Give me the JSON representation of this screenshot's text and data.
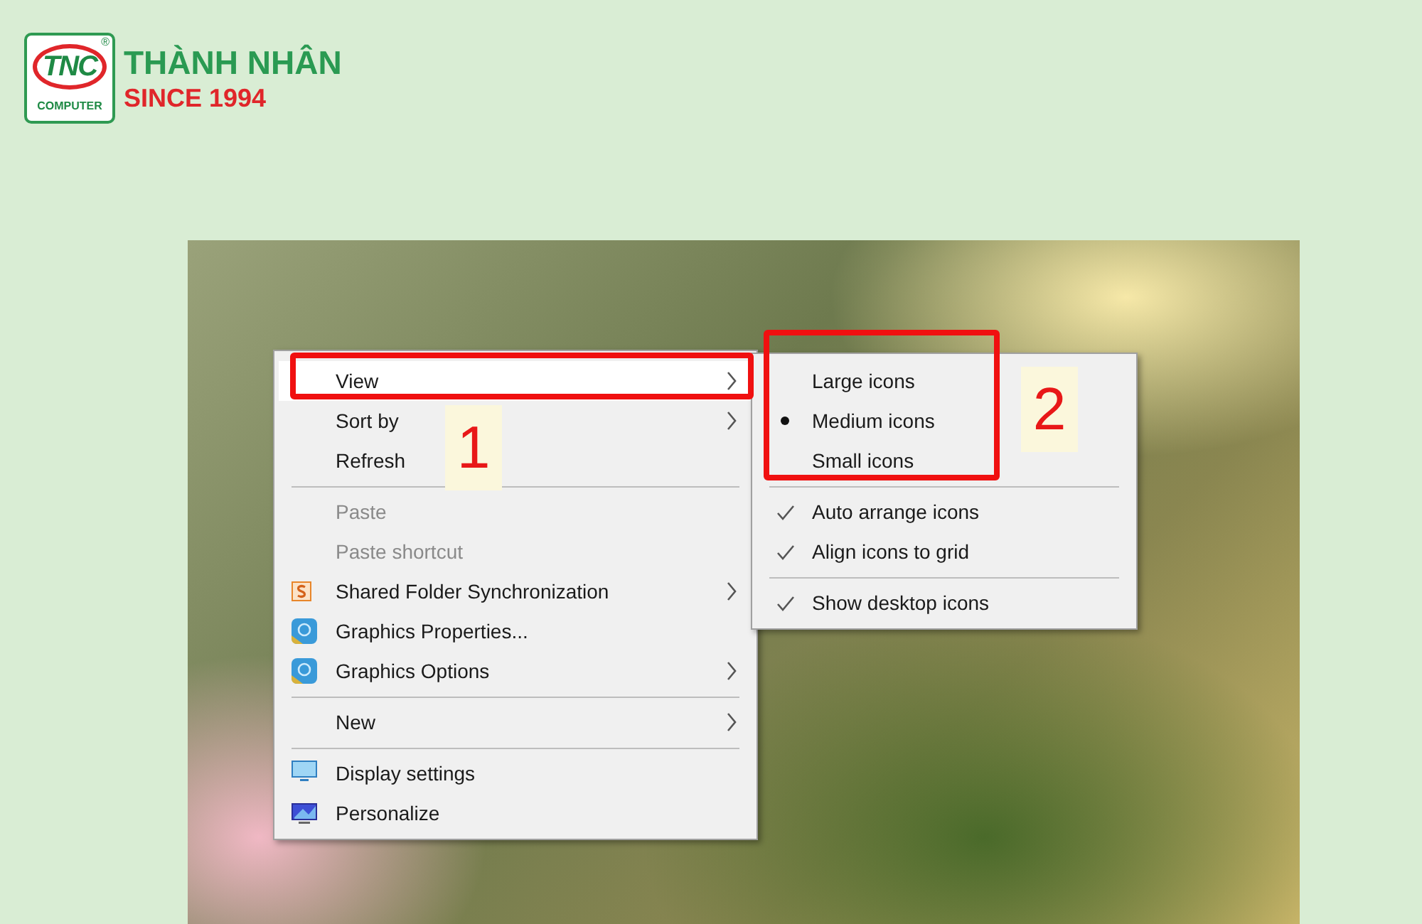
{
  "logo": {
    "mark": "TNC",
    "registered": "®",
    "subtitle": "COMPUTER",
    "name": "THÀNH NHÂN",
    "tagline": "SINCE 1994"
  },
  "context_menu": {
    "items": [
      {
        "kind": "item",
        "label": "View",
        "highlighted": true,
        "disabled": false,
        "submenu": true
      },
      {
        "kind": "item",
        "label": "Sort by",
        "highlighted": false,
        "disabled": false,
        "submenu": true
      },
      {
        "kind": "item",
        "label": "Refresh",
        "highlighted": false,
        "disabled": false,
        "submenu": false
      },
      {
        "kind": "separator"
      },
      {
        "kind": "item",
        "label": "Paste",
        "highlighted": false,
        "disabled": true,
        "submenu": false
      },
      {
        "kind": "item",
        "label": "Paste shortcut",
        "highlighted": false,
        "disabled": true,
        "submenu": false
      },
      {
        "kind": "item",
        "label": "Shared Folder Synchronization",
        "highlighted": false,
        "disabled": false,
        "submenu": true
      },
      {
        "kind": "item",
        "label": "Graphics Properties...",
        "highlighted": false,
        "disabled": false,
        "submenu": false
      },
      {
        "kind": "item",
        "label": "Graphics Options",
        "highlighted": false,
        "disabled": false,
        "submenu": true
      },
      {
        "kind": "separator"
      },
      {
        "kind": "item",
        "label": "New",
        "highlighted": false,
        "disabled": false,
        "submenu": true
      },
      {
        "kind": "separator"
      },
      {
        "kind": "item",
        "label": "Display settings",
        "highlighted": false,
        "disabled": false,
        "submenu": false
      },
      {
        "kind": "item",
        "label": "Personalize",
        "highlighted": false,
        "disabled": false,
        "submenu": false
      }
    ]
  },
  "view_submenu": {
    "items": [
      {
        "kind": "radio",
        "label": "Large icons",
        "selected": false
      },
      {
        "kind": "radio",
        "label": "Medium icons",
        "selected": true
      },
      {
        "kind": "radio",
        "label": "Small icons",
        "selected": false
      },
      {
        "kind": "separator"
      },
      {
        "kind": "check",
        "label": "Auto arrange icons",
        "checked": true
      },
      {
        "kind": "check",
        "label": "Align icons to grid",
        "checked": true
      },
      {
        "kind": "separator"
      },
      {
        "kind": "check",
        "label": "Show desktop icons",
        "checked": true
      }
    ]
  },
  "callouts": [
    {
      "number": "1"
    },
    {
      "number": "2"
    }
  ]
}
